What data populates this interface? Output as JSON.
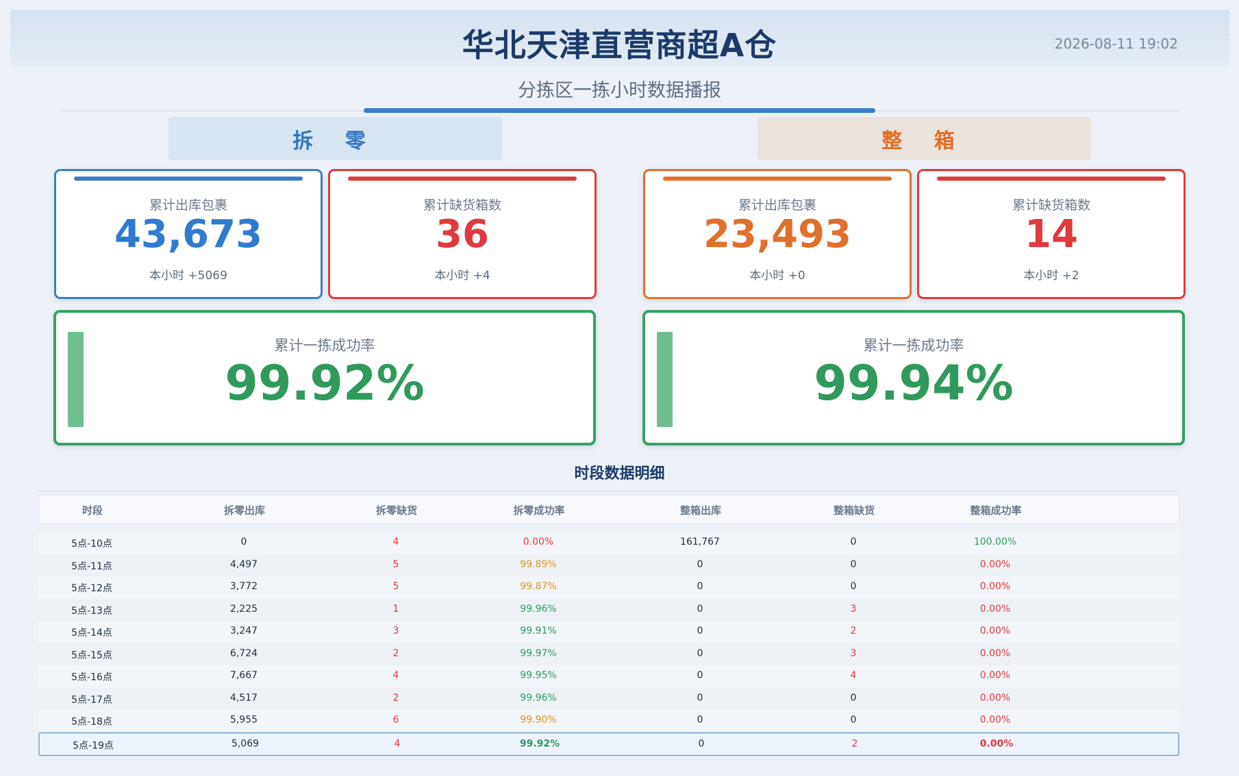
{
  "header": {
    "title": "华北天津直营商超A仓",
    "datetime": "2026-08-11 19:02",
    "subtitle": "分拣区一拣小时数据播报"
  },
  "sections": {
    "left_label": "拆 零",
    "right_label": "整 箱"
  },
  "colors": {
    "blue": "#3a7dc8",
    "red": "#e0393e",
    "orange": "#e0702a",
    "green": "#2f9a5c",
    "amber": "#d6952a"
  },
  "cards": {
    "split_out": {
      "label": "累计出库包裹",
      "value": "43,673",
      "delta": "本小时 +5069"
    },
    "split_short": {
      "label": "累计缺货箱数",
      "value": "36",
      "delta": "本小时 +4"
    },
    "box_out": {
      "label": "累计出库包裹",
      "value": "23,493",
      "delta": "本小时 +0"
    },
    "box_short": {
      "label": "累计缺货箱数",
      "value": "14",
      "delta": "本小时 +2"
    },
    "split_rate": {
      "label": "累计一拣成功率",
      "value": "99.92%"
    },
    "box_rate": {
      "label": "累计一拣成功率",
      "value": "99.94%"
    }
  },
  "table": {
    "title": "时段数据明细",
    "columns": [
      "时段",
      "拆零出库",
      "拆零缺货",
      "拆零成功率",
      "整箱出库",
      "整箱缺货",
      "整箱成功率"
    ],
    "rows": [
      {
        "period": "5点-10点",
        "split_out": "0",
        "split_short": "4",
        "split_rate": "0.00%",
        "split_rate_color": "red",
        "box_out": "161,767",
        "box_short": "0",
        "box_short_color": "dark",
        "box_rate": "100.00%",
        "box_rate_color": "green"
      },
      {
        "period": "5点-11点",
        "split_out": "4,497",
        "split_short": "5",
        "split_rate": "99.89%",
        "split_rate_color": "amber",
        "box_out": "0",
        "box_short": "0",
        "box_short_color": "dark",
        "box_rate": "0.00%",
        "box_rate_color": "red"
      },
      {
        "period": "5点-12点",
        "split_out": "3,772",
        "split_short": "5",
        "split_rate": "99.87%",
        "split_rate_color": "amber",
        "box_out": "0",
        "box_short": "0",
        "box_short_color": "dark",
        "box_rate": "0.00%",
        "box_rate_color": "red"
      },
      {
        "period": "5点-13点",
        "split_out": "2,225",
        "split_short": "1",
        "split_rate": "99.96%",
        "split_rate_color": "green",
        "box_out": "0",
        "box_short": "3",
        "box_short_color": "red",
        "box_rate": "0.00%",
        "box_rate_color": "red"
      },
      {
        "period": "5点-14点",
        "split_out": "3,247",
        "split_short": "3",
        "split_rate": "99.91%",
        "split_rate_color": "green",
        "box_out": "0",
        "box_short": "2",
        "box_short_color": "red",
        "box_rate": "0.00%",
        "box_rate_color": "red"
      },
      {
        "period": "5点-15点",
        "split_out": "6,724",
        "split_short": "2",
        "split_rate": "99.97%",
        "split_rate_color": "green",
        "box_out": "0",
        "box_short": "3",
        "box_short_color": "red",
        "box_rate": "0.00%",
        "box_rate_color": "red"
      },
      {
        "period": "5点-16点",
        "split_out": "7,667",
        "split_short": "4",
        "split_rate": "99.95%",
        "split_rate_color": "green",
        "box_out": "0",
        "box_short": "4",
        "box_short_color": "red",
        "box_rate": "0.00%",
        "box_rate_color": "red"
      },
      {
        "period": "5点-17点",
        "split_out": "4,517",
        "split_short": "2",
        "split_rate": "99.96%",
        "split_rate_color": "green",
        "box_out": "0",
        "box_short": "0",
        "box_short_color": "dark",
        "box_rate": "0.00%",
        "box_rate_color": "red"
      },
      {
        "period": "5点-18点",
        "split_out": "5,955",
        "split_short": "6",
        "split_rate": "99.90%",
        "split_rate_color": "amber",
        "box_out": "0",
        "box_short": "0",
        "box_short_color": "dark",
        "box_rate": "0.00%",
        "box_rate_color": "red"
      },
      {
        "period": "5点-19点",
        "split_out": "5,069",
        "split_short": "4",
        "split_rate": "99.92%",
        "split_rate_color": "green",
        "box_out": "0",
        "box_short": "2",
        "box_short_color": "red",
        "box_rate": "0.00%",
        "box_rate_color": "red"
      }
    ]
  }
}
